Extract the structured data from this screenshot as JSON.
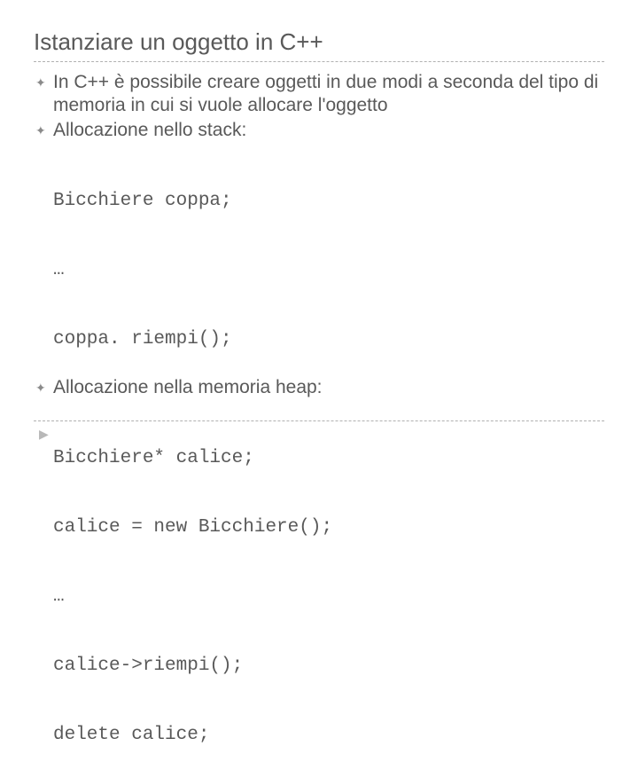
{
  "title": "Istanziare un oggetto in C++",
  "bullets": {
    "b1": "In C++ è possibile creare oggetti in due modi a seconda del tipo di memoria in cui si vuole allocare l'oggetto",
    "b2": "Allocazione nello stack:",
    "b3": "Allocazione nella memoria heap:"
  },
  "code1": {
    "l1": "Bicchiere coppa;",
    "l2": "…",
    "l3": "coppa. riempi();"
  },
  "code2": {
    "l1": "Bicchiere* calice;",
    "l2": "calice = new Bicchiere();",
    "l3": "…",
    "l4": "calice->riempi();",
    "l5": "delete calice;"
  },
  "symbols": {
    "bullet": "✦",
    "arrow": "▶"
  }
}
